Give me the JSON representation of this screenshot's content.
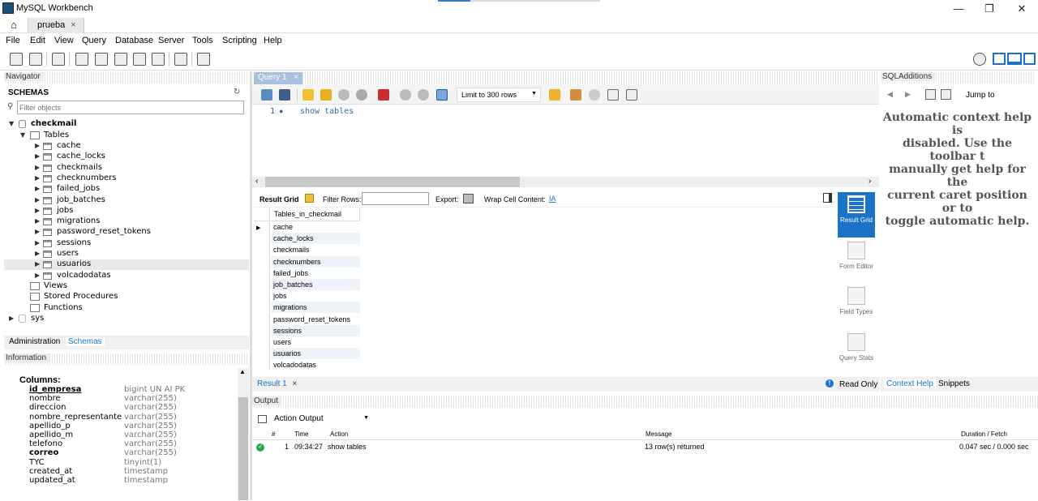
{
  "window": {
    "title": "MySQL Workbench",
    "connection_tab": "prueba",
    "close_glyph": "×",
    "minimize_glyph": "—",
    "maximize_glyph": "❐",
    "close_window_glyph": "✕"
  },
  "menu": [
    "File",
    "Edit",
    "View",
    "Query",
    "Database",
    "Server",
    "Tools",
    "Scripting",
    "Help"
  ],
  "navigator": {
    "header": "Navigator",
    "schemas_label": "SCHEMAS",
    "filter_placeholder": "Filter objects",
    "schemas": [
      {
        "name": "checkmail",
        "expanded": true,
        "tables_label": "Tables",
        "tables": [
          "cache",
          "cache_locks",
          "checkmails",
          "checknumbers",
          "failed_jobs",
          "job_batches",
          "jobs",
          "migrations",
          "password_reset_tokens",
          "sessions",
          "users",
          "usuarios",
          "volcadodatas"
        ],
        "other": [
          "Views",
          "Stored Procedures",
          "Functions"
        ]
      },
      {
        "name": "sys",
        "expanded": false
      }
    ],
    "bottom_tabs": [
      "Administration",
      "Schemas"
    ],
    "active_bottom_tab": "Schemas"
  },
  "information": {
    "header": "Information",
    "columns_label": "Columns:",
    "columns": [
      {
        "name": "id_empresa",
        "type": "bigint UN AI PK",
        "pk": true
      },
      {
        "name": "nombre",
        "type": "varchar(255)"
      },
      {
        "name": "direccion",
        "type": "varchar(255)"
      },
      {
        "name": "nombre_representante",
        "type": "varchar(255)"
      },
      {
        "name": "apellido_p",
        "type": "varchar(255)"
      },
      {
        "name": "apellido_m",
        "type": "varchar(255)"
      },
      {
        "name": "telefono",
        "type": "varchar(255)"
      },
      {
        "name": "correo",
        "type": "varchar(255)",
        "bold": true
      },
      {
        "name": "TYC",
        "type": "tinyint(1)"
      },
      {
        "name": "created_at",
        "type": "timestamp"
      },
      {
        "name": "updated_at",
        "type": "timestamp"
      }
    ]
  },
  "query": {
    "tab_label": "Query 1",
    "limit_label": "Limit to 300 rows",
    "line_number": "1",
    "sql": "show tables"
  },
  "result": {
    "result_grid_label": "Result Grid",
    "filter_rows_label": "Filter Rows:",
    "export_label": "Export:",
    "wrap_label": "Wrap Cell Content:",
    "column_header": "Tables_in_checkmail",
    "rows": [
      "cache",
      "cache_locks",
      "checkmails",
      "checknumbers",
      "failed_jobs",
      "job_batches",
      "jobs",
      "migrations",
      "password_reset_tokens",
      "sessions",
      "users",
      "usuarios",
      "volcadodatas"
    ],
    "side_buttons": [
      {
        "label": "Result Grid",
        "active": true
      },
      {
        "label": "Form Editor",
        "active": false
      },
      {
        "label": "Field Types",
        "active": false
      },
      {
        "label": "Query Stats",
        "active": false
      }
    ],
    "result_tab": "Result 1",
    "read_only": "Read Only"
  },
  "output": {
    "header": "Output",
    "selector": "Action Output",
    "columns": [
      "#",
      "Time",
      "Action",
      "Message",
      "Duration / Fetch"
    ],
    "rows": [
      {
        "num": "1",
        "time": "09:34:27",
        "action": "show tables",
        "message": "13 row(s) returned",
        "duration": "0.047 sec / 0.000 sec"
      }
    ]
  },
  "sql_additions": {
    "header": "SQLAdditions",
    "jump_to": "Jump to",
    "help_text": [
      "Automatic context help is",
      "disabled. Use the toolbar t",
      "manually get help for the",
      "current caret position or to",
      "toggle automatic help."
    ],
    "tabs": [
      "Context Help",
      "Snippets"
    ],
    "active_tab": "Context Help"
  },
  "colors": {
    "accent": "#1a73c9",
    "tab_blue": "#a8c1dc",
    "keyword": "#2b6cb0"
  }
}
